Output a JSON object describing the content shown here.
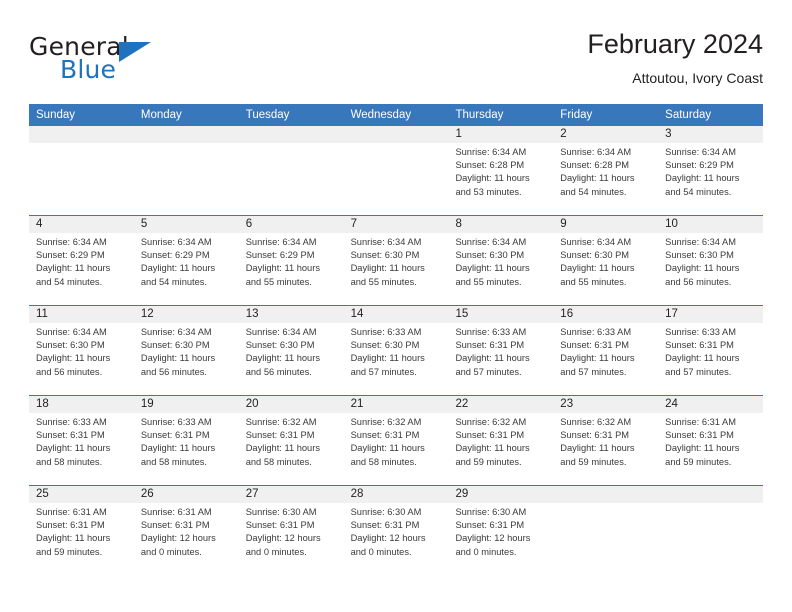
{
  "brand": {
    "name_top": "General",
    "name_bottom": "Blue",
    "accent_color": "#1f72bd"
  },
  "header": {
    "title": "February 2024",
    "subtitle": "Attoutou, Ivory Coast"
  },
  "calendar": {
    "header_color": "#3877bc",
    "daynum_band_color": "#f0f0f0",
    "weekdays": [
      "Sunday",
      "Monday",
      "Tuesday",
      "Wednesday",
      "Thursday",
      "Friday",
      "Saturday"
    ],
    "weeks": [
      [
        null,
        null,
        null,
        null,
        {
          "day": "1",
          "sunrise": "Sunrise: 6:34 AM",
          "sunset": "Sunset: 6:28 PM",
          "daylight": "Daylight: 11 hours and 53 minutes."
        },
        {
          "day": "2",
          "sunrise": "Sunrise: 6:34 AM",
          "sunset": "Sunset: 6:28 PM",
          "daylight": "Daylight: 11 hours and 54 minutes."
        },
        {
          "day": "3",
          "sunrise": "Sunrise: 6:34 AM",
          "sunset": "Sunset: 6:29 PM",
          "daylight": "Daylight: 11 hours and 54 minutes."
        }
      ],
      [
        {
          "day": "4",
          "sunrise": "Sunrise: 6:34 AM",
          "sunset": "Sunset: 6:29 PM",
          "daylight": "Daylight: 11 hours and 54 minutes."
        },
        {
          "day": "5",
          "sunrise": "Sunrise: 6:34 AM",
          "sunset": "Sunset: 6:29 PM",
          "daylight": "Daylight: 11 hours and 54 minutes."
        },
        {
          "day": "6",
          "sunrise": "Sunrise: 6:34 AM",
          "sunset": "Sunset: 6:29 PM",
          "daylight": "Daylight: 11 hours and 55 minutes."
        },
        {
          "day": "7",
          "sunrise": "Sunrise: 6:34 AM",
          "sunset": "Sunset: 6:30 PM",
          "daylight": "Daylight: 11 hours and 55 minutes."
        },
        {
          "day": "8",
          "sunrise": "Sunrise: 6:34 AM",
          "sunset": "Sunset: 6:30 PM",
          "daylight": "Daylight: 11 hours and 55 minutes."
        },
        {
          "day": "9",
          "sunrise": "Sunrise: 6:34 AM",
          "sunset": "Sunset: 6:30 PM",
          "daylight": "Daylight: 11 hours and 55 minutes."
        },
        {
          "day": "10",
          "sunrise": "Sunrise: 6:34 AM",
          "sunset": "Sunset: 6:30 PM",
          "daylight": "Daylight: 11 hours and 56 minutes."
        }
      ],
      [
        {
          "day": "11",
          "sunrise": "Sunrise: 6:34 AM",
          "sunset": "Sunset: 6:30 PM",
          "daylight": "Daylight: 11 hours and 56 minutes."
        },
        {
          "day": "12",
          "sunrise": "Sunrise: 6:34 AM",
          "sunset": "Sunset: 6:30 PM",
          "daylight": "Daylight: 11 hours and 56 minutes."
        },
        {
          "day": "13",
          "sunrise": "Sunrise: 6:34 AM",
          "sunset": "Sunset: 6:30 PM",
          "daylight": "Daylight: 11 hours and 56 minutes."
        },
        {
          "day": "14",
          "sunrise": "Sunrise: 6:33 AM",
          "sunset": "Sunset: 6:30 PM",
          "daylight": "Daylight: 11 hours and 57 minutes."
        },
        {
          "day": "15",
          "sunrise": "Sunrise: 6:33 AM",
          "sunset": "Sunset: 6:31 PM",
          "daylight": "Daylight: 11 hours and 57 minutes."
        },
        {
          "day": "16",
          "sunrise": "Sunrise: 6:33 AM",
          "sunset": "Sunset: 6:31 PM",
          "daylight": "Daylight: 11 hours and 57 minutes."
        },
        {
          "day": "17",
          "sunrise": "Sunrise: 6:33 AM",
          "sunset": "Sunset: 6:31 PM",
          "daylight": "Daylight: 11 hours and 57 minutes."
        }
      ],
      [
        {
          "day": "18",
          "sunrise": "Sunrise: 6:33 AM",
          "sunset": "Sunset: 6:31 PM",
          "daylight": "Daylight: 11 hours and 58 minutes."
        },
        {
          "day": "19",
          "sunrise": "Sunrise: 6:33 AM",
          "sunset": "Sunset: 6:31 PM",
          "daylight": "Daylight: 11 hours and 58 minutes."
        },
        {
          "day": "20",
          "sunrise": "Sunrise: 6:32 AM",
          "sunset": "Sunset: 6:31 PM",
          "daylight": "Daylight: 11 hours and 58 minutes."
        },
        {
          "day": "21",
          "sunrise": "Sunrise: 6:32 AM",
          "sunset": "Sunset: 6:31 PM",
          "daylight": "Daylight: 11 hours and 58 minutes."
        },
        {
          "day": "22",
          "sunrise": "Sunrise: 6:32 AM",
          "sunset": "Sunset: 6:31 PM",
          "daylight": "Daylight: 11 hours and 59 minutes."
        },
        {
          "day": "23",
          "sunrise": "Sunrise: 6:32 AM",
          "sunset": "Sunset: 6:31 PM",
          "daylight": "Daylight: 11 hours and 59 minutes."
        },
        {
          "day": "24",
          "sunrise": "Sunrise: 6:31 AM",
          "sunset": "Sunset: 6:31 PM",
          "daylight": "Daylight: 11 hours and 59 minutes."
        }
      ],
      [
        {
          "day": "25",
          "sunrise": "Sunrise: 6:31 AM",
          "sunset": "Sunset: 6:31 PM",
          "daylight": "Daylight: 11 hours and 59 minutes."
        },
        {
          "day": "26",
          "sunrise": "Sunrise: 6:31 AM",
          "sunset": "Sunset: 6:31 PM",
          "daylight": "Daylight: 12 hours and 0 minutes."
        },
        {
          "day": "27",
          "sunrise": "Sunrise: 6:30 AM",
          "sunset": "Sunset: 6:31 PM",
          "daylight": "Daylight: 12 hours and 0 minutes."
        },
        {
          "day": "28",
          "sunrise": "Sunrise: 6:30 AM",
          "sunset": "Sunset: 6:31 PM",
          "daylight": "Daylight: 12 hours and 0 minutes."
        },
        {
          "day": "29",
          "sunrise": "Sunrise: 6:30 AM",
          "sunset": "Sunset: 6:31 PM",
          "daylight": "Daylight: 12 hours and 0 minutes."
        },
        null,
        null
      ]
    ]
  }
}
